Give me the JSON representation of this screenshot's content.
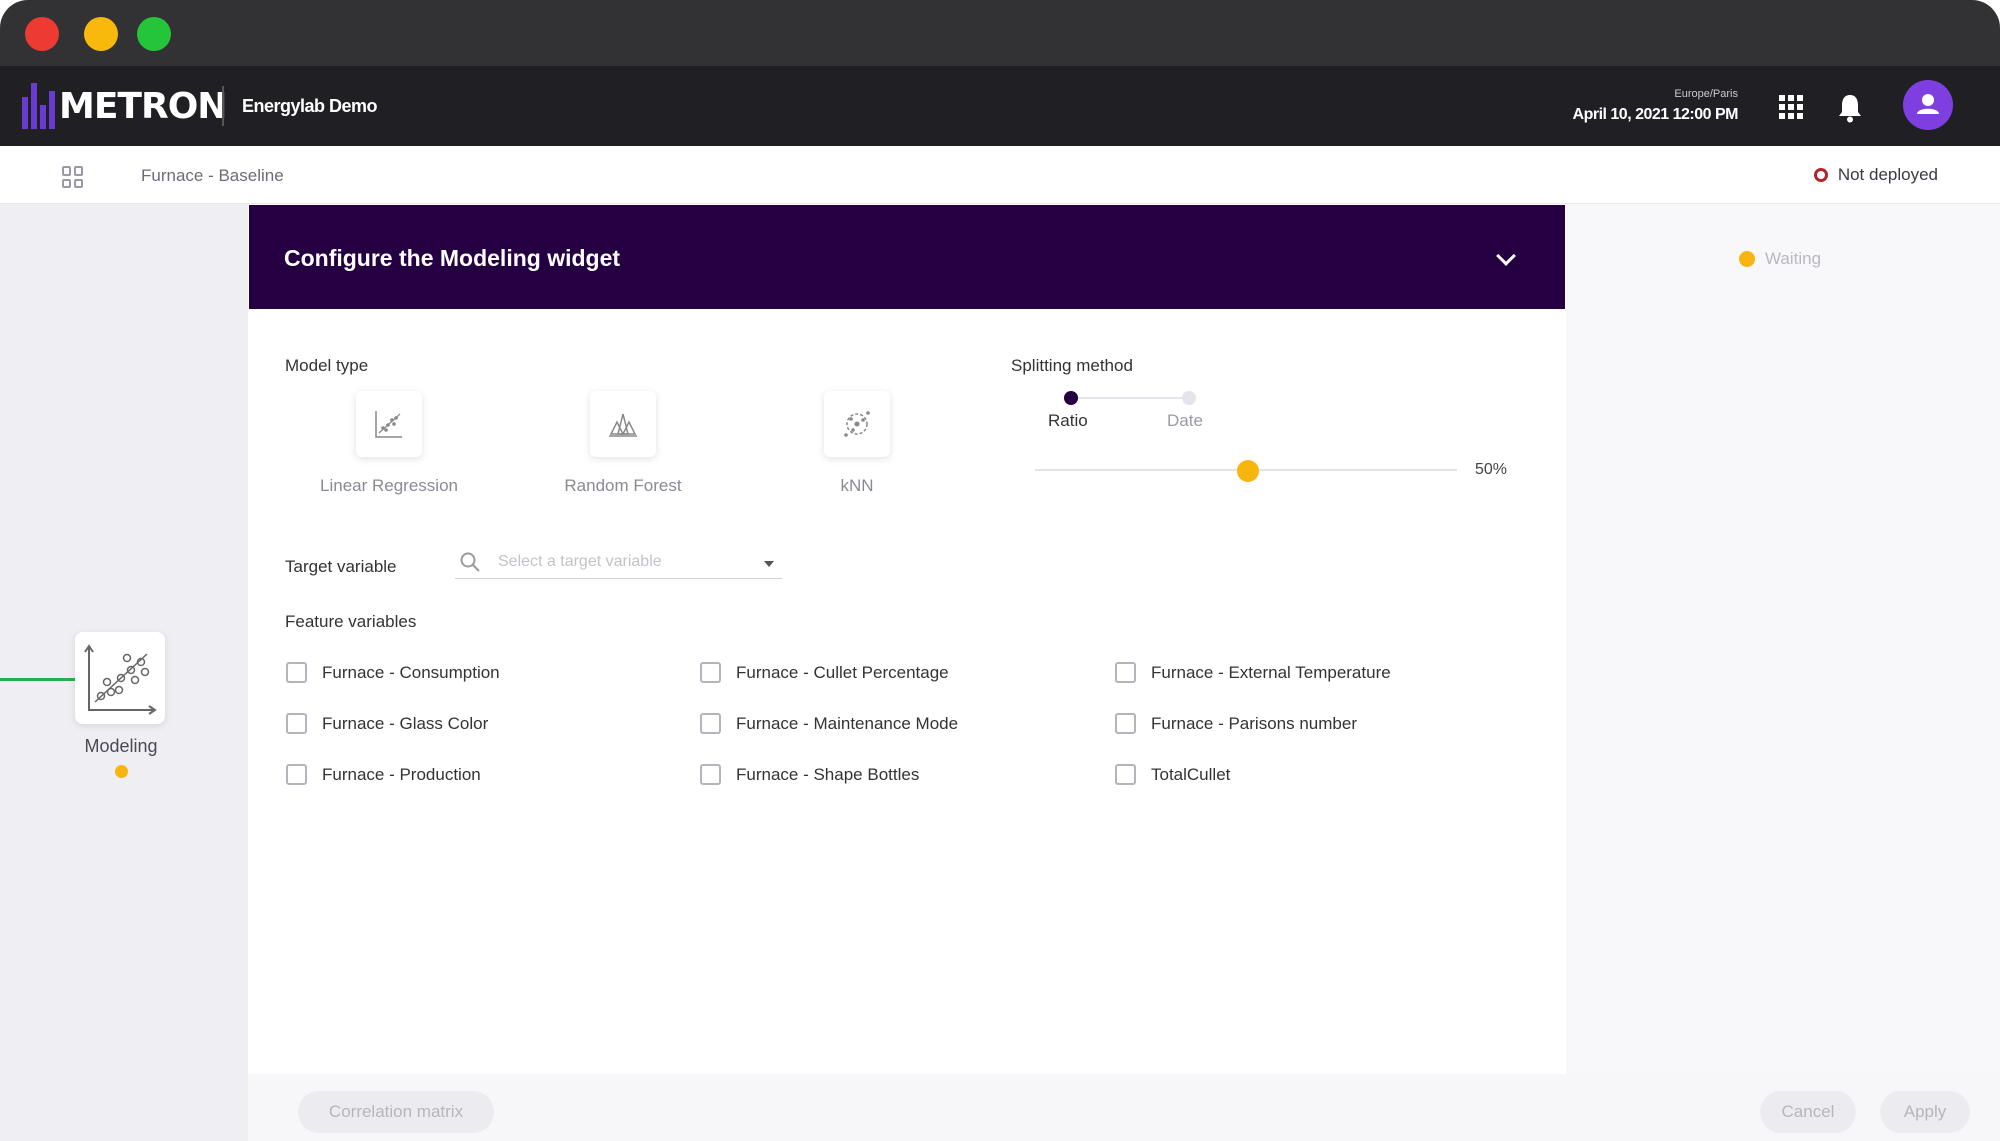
{
  "app": {
    "logo_text": "METRON",
    "workspace": "Energylab Demo",
    "timezone": "Europe/Paris",
    "datetime": "April 10, 2021 12:00 PM"
  },
  "subheader": {
    "breadcrumb": "Furnace - Baseline",
    "deploy_status": "Not deployed",
    "deploy_status_color": "#b3242c"
  },
  "canvas": {
    "node_label": "Modeling",
    "node_icon": "scatter-plot-icon",
    "node_status_color": "#f7b50e",
    "run_status": "Waiting"
  },
  "panel": {
    "title": "Configure the Modeling widget",
    "header_color": "#240042",
    "model_type_label": "Model type",
    "models": [
      {
        "name": "Linear Regression",
        "icon": "linear-regression-icon"
      },
      {
        "name": "Random Forest",
        "icon": "random-forest-icon"
      },
      {
        "name": "kNN",
        "icon": "knn-icon"
      }
    ],
    "splitting_label": "Splitting method",
    "split_options": [
      "Ratio",
      "Date"
    ],
    "split_selected": "Ratio",
    "ratio_value_text": "50%",
    "ratio_value": 0.5,
    "target_label": "Target variable",
    "target_placeholder": "Select a target variable",
    "feature_label": "Feature variables",
    "features": [
      "Furnace - Consumption",
      "Furnace - Cullet Percentage",
      "Furnace - External Temperature",
      "Furnace - Glass Color",
      "Furnace - Maintenance Mode",
      "Furnace - Parisons number",
      "Furnace - Production",
      "Furnace - Shape Bottles",
      "TotalCullet"
    ],
    "accent_color": "#f7b50e"
  },
  "footer": {
    "correlation_label": "Correlation matrix",
    "cancel_label": "Cancel",
    "apply_label": "Apply"
  }
}
